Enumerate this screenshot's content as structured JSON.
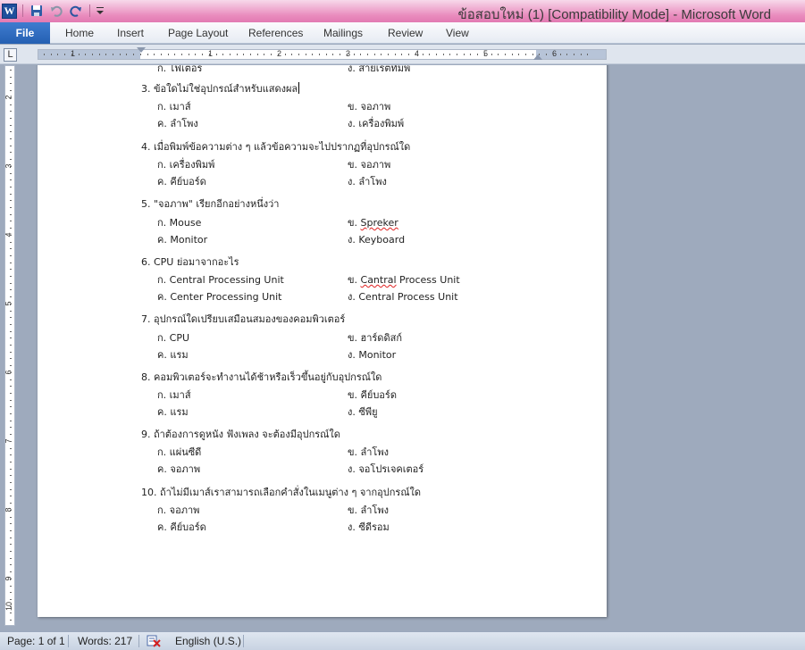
{
  "window": {
    "title": "ข้อสอบใหม่ (1) [Compatibility Mode]  -  Microsoft Word"
  },
  "qat": {
    "app_icon": "word-icon",
    "buttons": [
      "save-icon",
      "undo-icon",
      "redo-icon",
      "customize-qat-icon"
    ]
  },
  "ribbon": {
    "file_label": "File",
    "tabs": [
      "Home",
      "Insert",
      "Page Layout",
      "References",
      "Mailings",
      "Review",
      "View"
    ]
  },
  "ruler": {
    "corner_glyph": "L",
    "h_numbers": [
      "1",
      "1",
      "2",
      "3",
      "4",
      "5",
      "6"
    ],
    "v_numbers": [
      "2",
      "3",
      "4",
      "5",
      "6",
      "7",
      "8",
      "9",
      "10"
    ]
  },
  "document": {
    "top_partial": {
      "left": "ก. ไฟเตอร",
      "right": "ง. สายเรตทิมพ์"
    },
    "questions": [
      {
        "q": "3.  ข้อใดไม่ใช่อุปกรณ์สำหรับแสดงผล",
        "a": "ก. เมาส์",
        "b": "ข. จอภาพ",
        "c": "ค. ลำโพง",
        "d": "ง. เครื่องพิมพ์"
      },
      {
        "q": "4.  เมื่อพิมพ์ข้อความต่าง ๆ แล้วข้อความจะไปปรากฏที่อุปกรณ์ใด",
        "a": "ก. เครื่องพิมพ์",
        "b": "ข. จอภาพ",
        "c": "ค. คีย์บอร์ด",
        "d": "ง. ลำโพง"
      },
      {
        "q": "5.  \"จอภาพ\" เรียกอีกอย่างหนึ่งว่า",
        "a": "ก. Mouse",
        "b_prefix": "ข. ",
        "b_word": "Spreker",
        "c": "ค. Monitor",
        "d": "ง. Keyboard"
      },
      {
        "q": "6.  CPU ย่อมาจากอะไร",
        "a": "ก. Central Processing Unit",
        "b_prefix": "ข. ",
        "b_word": "Cantral",
        "b_suffix": " Process Unit",
        "c": "ค. Center Processing Unit",
        "d": "ง. Central Process Unit"
      },
      {
        "q": "7.  อุปกรณ์ใดเปรียบเสมือนสมองของคอมพิวเตอร์",
        "a": "ก. CPU",
        "b": "ข. ฮาร์ดดิสก์",
        "c": "ค. แรม",
        "d": "ง. Monitor"
      },
      {
        "q": "8.  คอมพิวเตอร์จะทำงานได้ช้าหรือเร็วขึ้นอยู่กับอุปกรณ์ใด",
        "a": "ก. เมาส์",
        "b": "ข. คีย์บอร์ด",
        "c": "ค. แรม",
        "d": "ง. ซีพียู"
      },
      {
        "q": "9.  ถ้าต้องการดูหนัง ฟังเพลง จะต้องมีอุปกรณ์ใด",
        "a": "ก. แผ่นซีดี",
        "b": "ข. ลำโพง",
        "c": "ค. จอภาพ",
        "d": "ง. จอโปรเจคเตอร์"
      },
      {
        "q": "10. ถ้าไม่มีเมาส์เราสามารถเลือกคำสั่งในเมนูต่าง ๆ จากอุปกรณ์ใด",
        "a": "ก. จอภาพ",
        "b": "ข. ลำโพง",
        "c": "ค. คีย์บอร์ด",
        "d": "ง. ซีดีรอม"
      }
    ]
  },
  "status": {
    "page": "Page: 1 of 1",
    "words": "Words: 217",
    "proofing_icon": "proofing-errors-icon",
    "language": "English (U.S.)"
  },
  "colors": {
    "titlebar": "#e98bbd",
    "file_tab": "#2b65b8",
    "workspace": "#9eaabd",
    "spelling_error": "#e02020"
  }
}
